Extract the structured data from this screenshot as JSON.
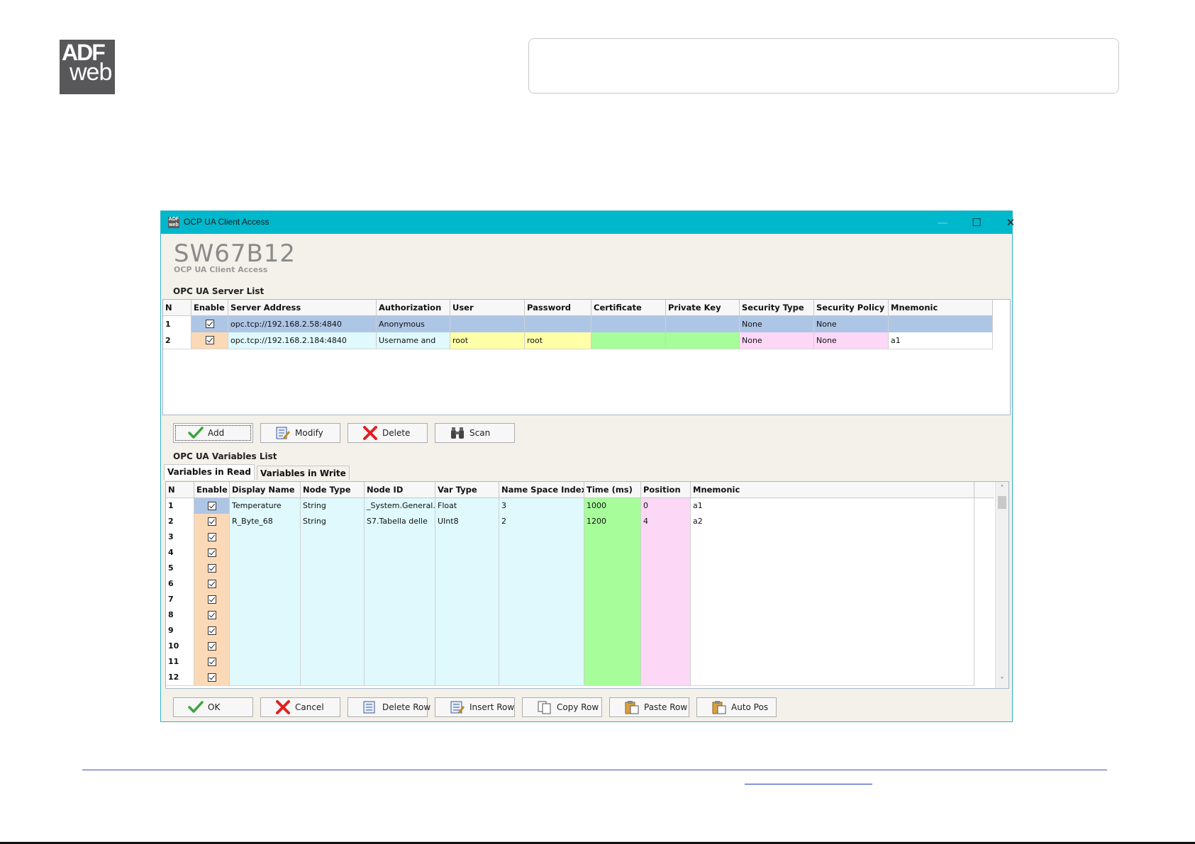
{
  "logo": {
    "line1": "ADF",
    "line2": "web"
  },
  "window": {
    "title": "OCP UA Client Access",
    "minimize": "—",
    "maximize": "☐",
    "close": "✕",
    "heading": "SW67B12",
    "subheading": "OCP UA Client Access"
  },
  "server_list": {
    "label": "OPC UA Server List",
    "columns": [
      "N",
      "Enable",
      "Server Address",
      "Authorization",
      "User",
      "Password",
      "Certificate",
      "Private Key",
      "Security Type",
      "Security Policy",
      "Mnemonic"
    ],
    "rows": [
      {
        "n": "1",
        "enabled": true,
        "address": "opc.tcp://192.168.2.58:4840",
        "auth": "Anonymous",
        "user": "",
        "password": "",
        "certificate": "",
        "private_key": "",
        "security_type": "None",
        "security_policy": "None",
        "mnemonic": ""
      },
      {
        "n": "2",
        "enabled": true,
        "address": "opc.tcp://192.168.2.184:4840",
        "auth": "Username and",
        "user": "root",
        "password": "root",
        "certificate": "",
        "private_key": "",
        "security_type": "None",
        "security_policy": "None",
        "mnemonic": "a1"
      }
    ]
  },
  "server_buttons": {
    "add": "Add",
    "modify": "Modify",
    "delete": "Delete",
    "scan": "Scan"
  },
  "variables_list": {
    "label": "OPC UA Variables List",
    "tabs": {
      "read": "Variables in Read",
      "write": "Variables in Write"
    },
    "columns": [
      "N",
      "Enable",
      "Display Name",
      "Node Type",
      "Node ID",
      "Var Type",
      "Name Space Index",
      "Time (ms)",
      "Position",
      "Mnemonic"
    ],
    "rows": [
      {
        "n": "1",
        "enabled": true,
        "display_name": "Temperature",
        "node_type": "String",
        "node_id": "_System.General.T",
        "var_type": "Float",
        "ns_index": "3",
        "time": "1000",
        "position": "0",
        "mnemonic": "a1"
      },
      {
        "n": "2",
        "enabled": true,
        "display_name": "R_Byte_68",
        "node_type": "String",
        "node_id": "S7.Tabella delle",
        "var_type": "UInt8",
        "ns_index": "2",
        "time": "1200",
        "position": "4",
        "mnemonic": "a2"
      },
      {
        "n": "3",
        "enabled": true
      },
      {
        "n": "4",
        "enabled": true
      },
      {
        "n": "5",
        "enabled": true
      },
      {
        "n": "6",
        "enabled": true
      },
      {
        "n": "7",
        "enabled": true
      },
      {
        "n": "8",
        "enabled": true
      },
      {
        "n": "9",
        "enabled": true
      },
      {
        "n": "10",
        "enabled": true
      },
      {
        "n": "11",
        "enabled": true
      },
      {
        "n": "12",
        "enabled": true
      }
    ],
    "scroll_up": "˄",
    "scroll_down": "˅"
  },
  "bottom_buttons": {
    "ok": "OK",
    "cancel": "Cancel",
    "delete_row": "Delete Row",
    "insert_row": "Insert Row",
    "copy_row": "Copy Row",
    "paste_row": "Paste Row",
    "auto_pos": "Auto Pos"
  },
  "colors": {
    "titlebar": "#00b8cc",
    "selected_row": "#aec6e6",
    "enable_cell": "#fcd9b6",
    "light_cyan": "#dff9fd",
    "yellow": "#ffffa8",
    "green": "#a6fd9a",
    "pink": "#fdd7f6"
  }
}
